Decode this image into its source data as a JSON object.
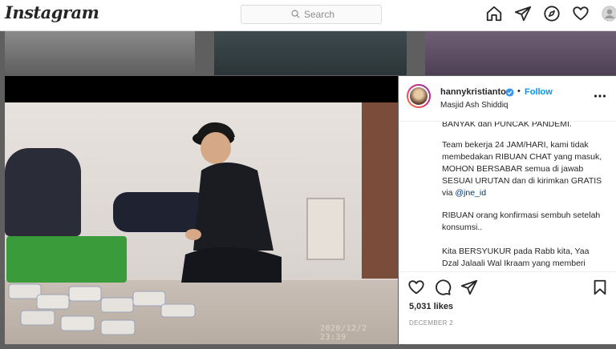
{
  "nav": {
    "logo_text": "Instagram",
    "search_placeholder": "Search",
    "icons": [
      "home-icon",
      "direct-icon",
      "explore-icon",
      "heart-icon",
      "profile-avatar"
    ]
  },
  "photo": {
    "timestamp": "2020/12/2  23:39"
  },
  "post": {
    "username": "hannykristianto",
    "follow_label": "Follow",
    "separator": "•",
    "location": "Masjid Ash Shiddiq",
    "caption": {
      "line0": "BANYAK dan PUNCAK PANDEMI.",
      "para1": "Team bekerja 24 JAM/HARI, kami tidak membedakan RIBUAN CHAT yang masuk, MOHON BERSABAR semua di jawab SESUAI URUTAN dan di kirimkan GRATIS via",
      "mention": "@jne_id",
      "para2": "RIBUAN orang konfirmasi sembuh setelah konsumsi..",
      "para3": "Kita BERSYUKUR pada Rabb kita, Yaa Dzal Jalaali Wal Ikraam yang memberi"
    },
    "likes": "5,031 likes",
    "date": "DECEMBER 2"
  },
  "colors": {
    "link_blue": "#0095f6",
    "mention": "#00376b",
    "text": "#262626",
    "muted": "#8e8e8e"
  }
}
